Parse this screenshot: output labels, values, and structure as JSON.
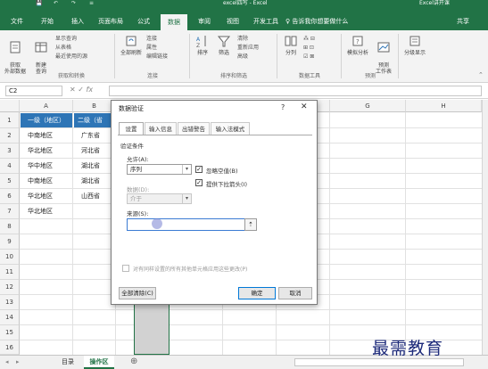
{
  "title_bar": {
    "quick_access": [
      "💾",
      "↶",
      "↷",
      "≡"
    ],
    "title": "excel四写 - Excel",
    "account": "Excel讲开课"
  },
  "tabs": [
    {
      "label": "文件",
      "active": false
    },
    {
      "label": "开始",
      "active": false
    },
    {
      "label": "插入",
      "active": false
    },
    {
      "label": "页面布局",
      "active": false
    },
    {
      "label": "公式",
      "active": false
    },
    {
      "label": "数据",
      "active": true
    },
    {
      "label": "审阅",
      "active": false
    },
    {
      "label": "视图",
      "active": false
    },
    {
      "label": "开发工具",
      "active": false
    }
  ],
  "tell_me": "告诉我你想要做什么",
  "share": "共享",
  "ribbon": {
    "get_external": "获取\n外部数据",
    "new_query": "新建\n查询",
    "query_items": [
      "显示查询",
      "从表格",
      "最近使用的源"
    ],
    "group_get": "获取和转换",
    "refresh_all": "全部刷新",
    "conn_items": [
      "连接",
      "属性",
      "编辑链接"
    ],
    "group_conn": "连接",
    "sort": "排序",
    "filter": "筛选",
    "filter_items": [
      "清除",
      "重新应用",
      "高级"
    ],
    "group_sort": "排序和筛选",
    "split": "分列",
    "group_tools": "数据工具",
    "whatif": "模拟分析",
    "forecast": "预测\n工作表",
    "group_forecast": "预测",
    "outline": "分级显示"
  },
  "formula_bar": {
    "name_box": "C2",
    "fx": "fx"
  },
  "columns": [
    "A",
    "B",
    "C",
    "D",
    "E",
    "F",
    "G",
    "H"
  ],
  "rows": [
    "1",
    "2",
    "3",
    "4",
    "5",
    "6",
    "7",
    "8",
    "9",
    "10",
    "11",
    "12",
    "13",
    "14",
    "15",
    "16"
  ],
  "table": {
    "header": [
      "一级（地区）",
      "二级（省"
    ],
    "rows": [
      [
        "中南地区",
        "广东省"
      ],
      [
        "华北地区",
        "河北省"
      ],
      [
        "华中地区",
        "湖北省"
      ],
      [
        "中南地区",
        "湖北省"
      ],
      [
        "华北地区",
        "山西省"
      ],
      [
        "华北地区",
        ""
      ]
    ]
  },
  "dialog": {
    "title": "数据验证",
    "help": "?",
    "close": "✕",
    "tabs": [
      "设置",
      "输入信息",
      "出错警告",
      "输入法模式"
    ],
    "section": "验证条件",
    "allow_label": "允许(A):",
    "allow_value": "序列",
    "ignore_blank": "忽略空值(B)",
    "dropdown": "提供下拉箭头(I)",
    "data_label": "数据(D):",
    "data_value": "介于",
    "source_label": "来源(S):",
    "source_value": "",
    "apply_all": "对有同样设置的所有其他单元格应用这些更改(P)",
    "clear_all": "全部清除(C)",
    "ok": "确定",
    "cancel": "取消"
  },
  "sheets": [
    {
      "label": "目录",
      "active": false
    },
    {
      "label": "操作区",
      "active": true
    }
  ],
  "add_sheet": "⊕",
  "watermark": "最需教育",
  "colors": {
    "excel_green": "#217346",
    "header_blue": "#2e75b6"
  }
}
